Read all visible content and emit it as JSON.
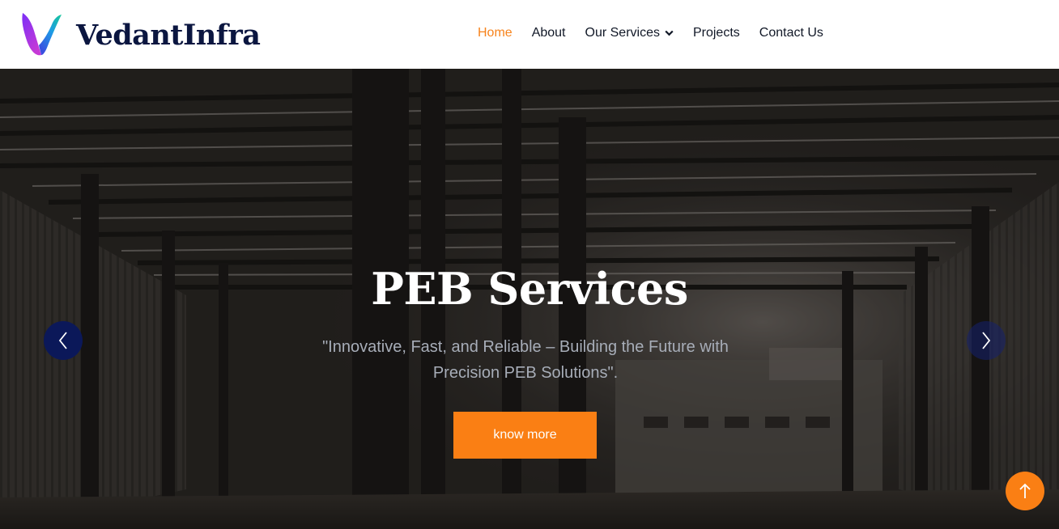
{
  "brand": {
    "name": "VedantInfra",
    "logo_icon": "v-logo-icon"
  },
  "nav": {
    "items": [
      {
        "label": "Home",
        "active": true
      },
      {
        "label": "About",
        "active": false
      },
      {
        "label": "Our Services",
        "active": false,
        "dropdown": true
      },
      {
        "label": "Projects",
        "active": false
      },
      {
        "label": "Contact Us",
        "active": false
      }
    ]
  },
  "hero": {
    "title": "PEB Services",
    "subtitle": "\"Innovative, Fast, and Reliable – Building the Future with Precision PEB Solutions\".",
    "cta_label": "know more",
    "prev_icon": "chevron-left-icon",
    "next_icon": "chevron-right-icon"
  },
  "scroll_top_icon": "arrow-up-icon",
  "colors": {
    "accent": "#fa7f14",
    "brand_navy": "#0b1640",
    "nav_active": "#f7831c",
    "slider_arrow": "#0b1859"
  }
}
